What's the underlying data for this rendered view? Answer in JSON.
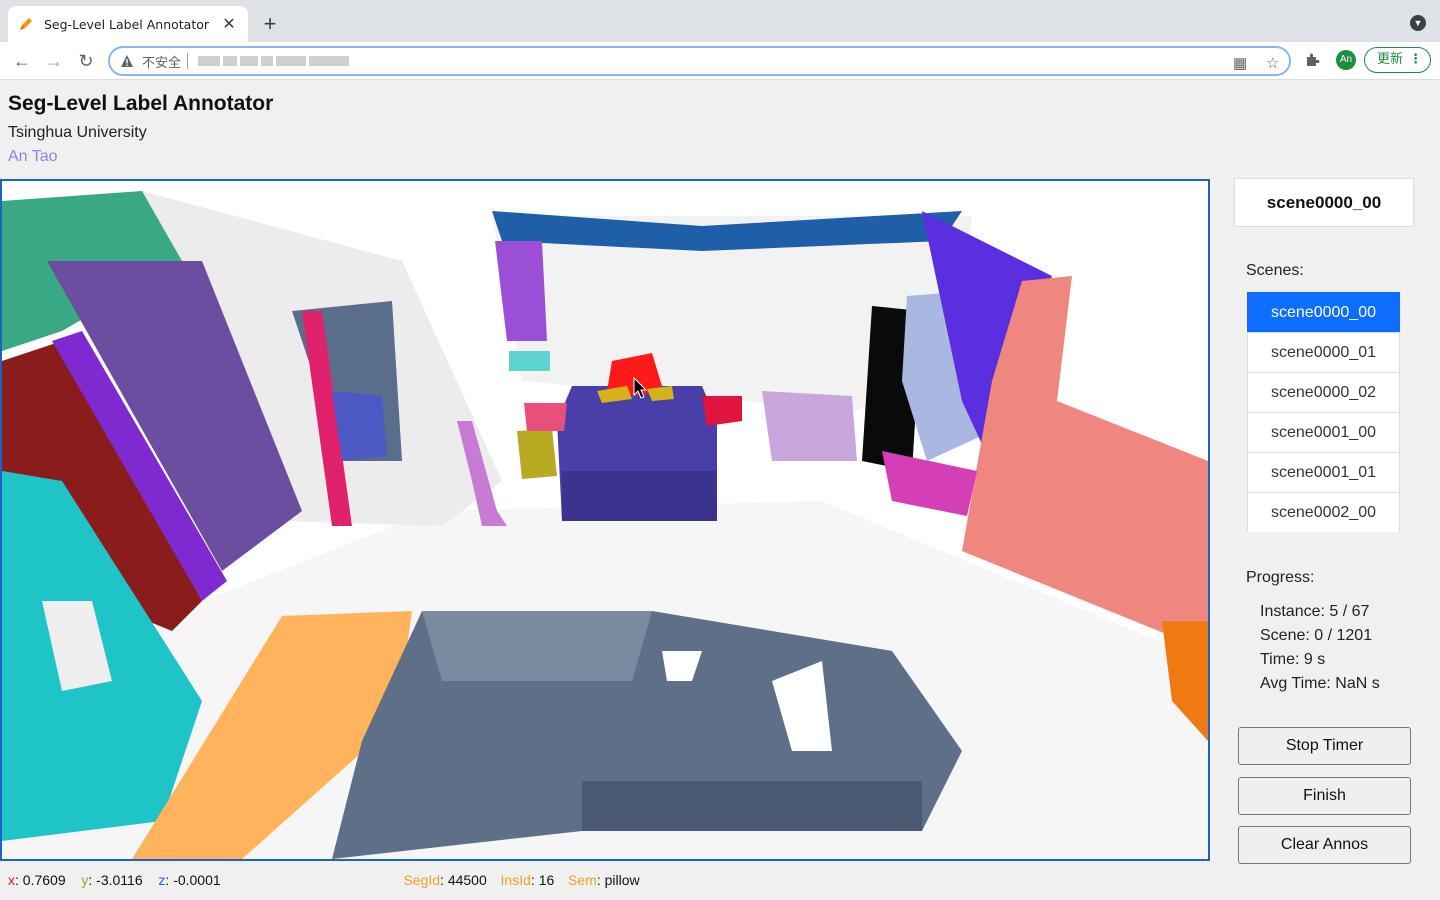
{
  "browser": {
    "tab_title": "Seg-Level Label Annotator",
    "tab_close": "✕",
    "new_tab": "+",
    "security_label": "不安全",
    "update_label": "更新",
    "avatar_initials": "An",
    "icons": [
      "back-icon",
      "forward-icon",
      "reload-icon",
      "warning-icon",
      "qr-icon",
      "star-icon",
      "extensions-icon",
      "menu-icon"
    ]
  },
  "header": {
    "title": "Seg-Level Label Annotator",
    "affiliation": "Tsinghua University",
    "author": "An Tao"
  },
  "status": {
    "x_label": "x",
    "x_value": "0.7609",
    "y_label": "y",
    "y_value": "-3.0116",
    "z_label": "z",
    "z_value": "-0.0001",
    "segid_label": "SegId",
    "segid_value": "44500",
    "insid_label": "InsId",
    "insid_value": "16",
    "sem_label": "Sem",
    "sem_value": "pillow"
  },
  "sidebar": {
    "current_scene": "scene0000_00",
    "scenes_label": "Scenes:",
    "scenes": [
      {
        "label": "scene0000_00",
        "active": true
      },
      {
        "label": "scene0000_01",
        "active": false
      },
      {
        "label": "scene0000_02",
        "active": false
      },
      {
        "label": "scene0001_00",
        "active": false
      },
      {
        "label": "scene0001_01",
        "active": false
      },
      {
        "label": "scene0002_00",
        "active": false
      }
    ],
    "progress_label": "Progress:",
    "instance": "Instance: 5 / 67",
    "scene": "Scene: 0 / 1201",
    "time": "Time: 9 s",
    "avg_time": "Avg Time: NaN s",
    "buttons": {
      "stop_timer": "Stop Timer",
      "finish": "Finish",
      "clear_annos": "Clear Annos"
    }
  },
  "colors": {
    "accent": "#0d6efd",
    "viewport_border": "#1b63c7",
    "author_link": "#9a7be8"
  }
}
